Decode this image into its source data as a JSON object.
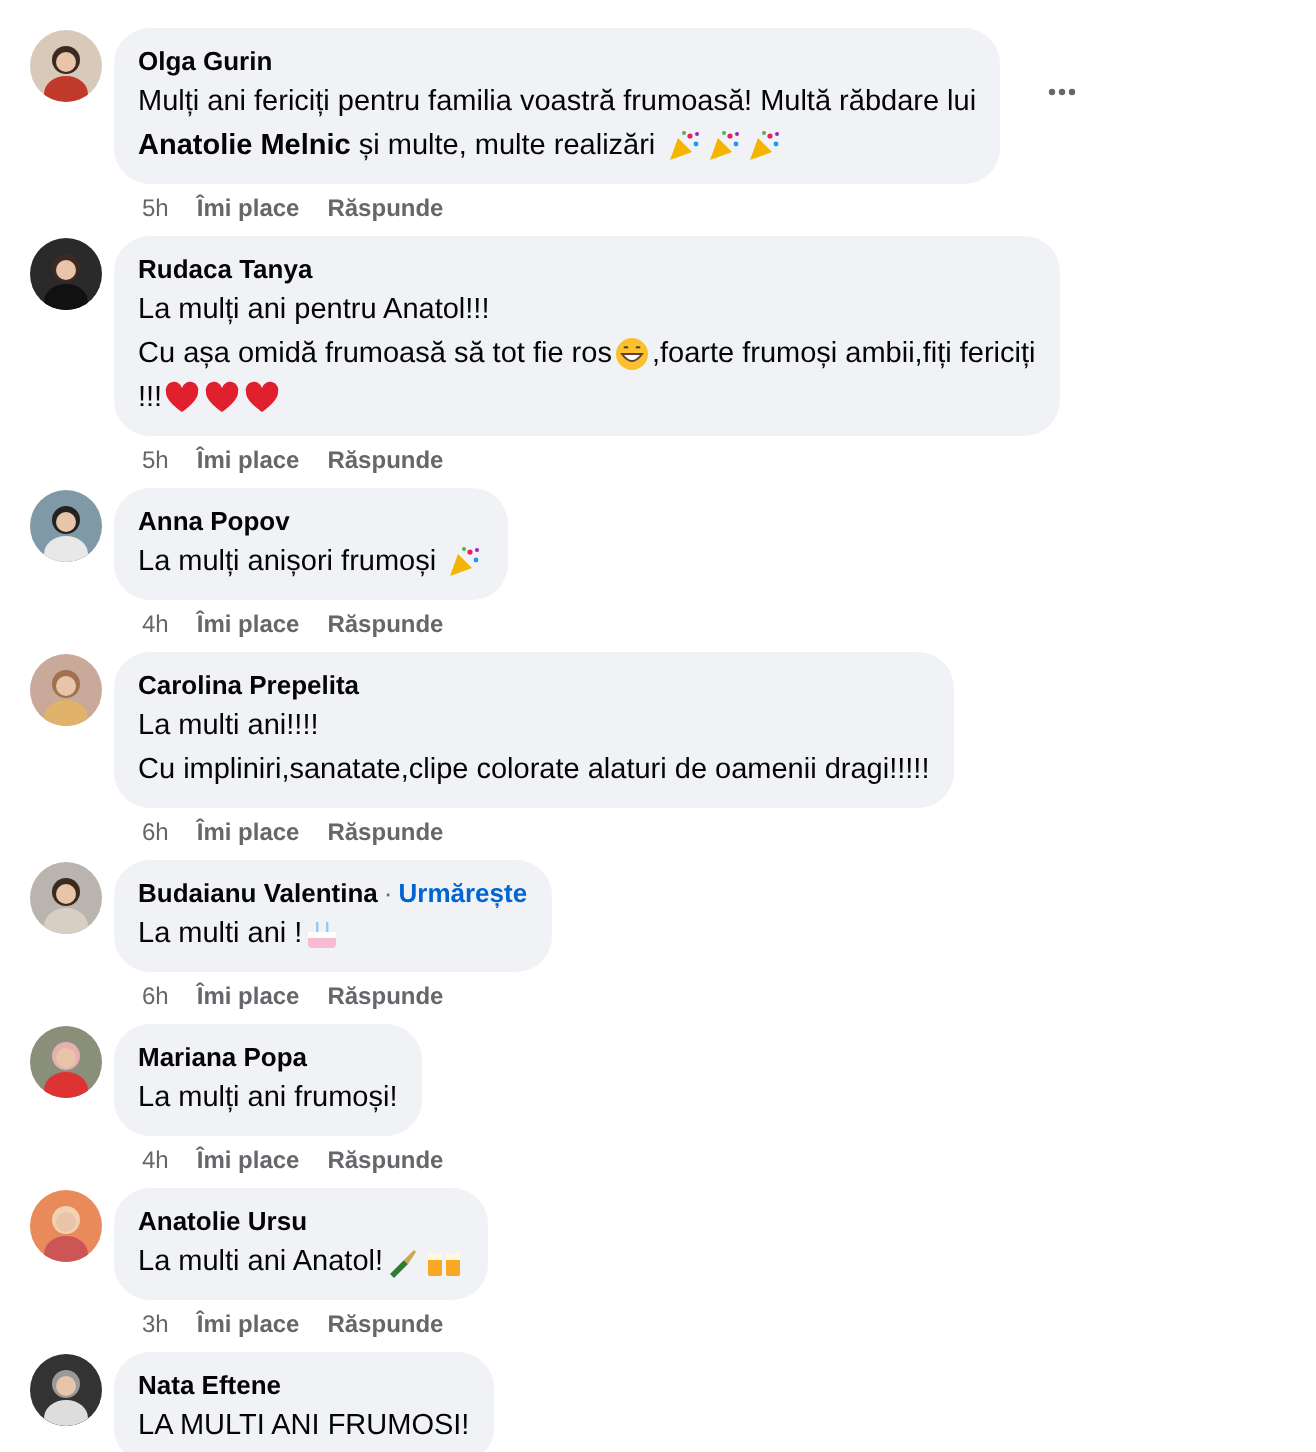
{
  "comments": [
    {
      "author": "Olga Gurin",
      "lines": [
        [
          {
            "kind": "text",
            "text": "Mulți ani fericiți pentru familia voastră frumoasă! Multă răbdare lui"
          }
        ],
        [
          {
            "kind": "text",
            "text": "**Anatolie Melnic** și multe, multe realizări "
          },
          {
            "kind": "party"
          },
          {
            "kind": "party"
          },
          {
            "kind": "party"
          }
        ]
      ],
      "time": "5h",
      "like": "Îmi place",
      "reply": "Răspunde",
      "menu": true
    },
    {
      "author": "Rudaca Tanya",
      "lines": [
        [
          {
            "kind": "text",
            "text": "La mulți ani pentru Anatol!!!"
          }
        ],
        [
          {
            "kind": "text",
            "text": "Cu așa omidă frumoasă să tot fie ros"
          },
          {
            "kind": "grin"
          },
          {
            "kind": "text",
            "text": ",foarte frumoși ambii,fiți fericiți"
          }
        ],
        [
          {
            "kind": "text",
            "text": "!!!"
          },
          {
            "kind": "heart"
          },
          {
            "kind": "heart"
          },
          {
            "kind": "heart"
          }
        ]
      ],
      "time": "5h",
      "like": "Îmi place",
      "reply": "Răspunde",
      "menu": false
    },
    {
      "author": "Anna Popov",
      "lines": [
        [
          {
            "kind": "text",
            "text": "La mulți anișori frumoși "
          },
          {
            "kind": "party"
          }
        ]
      ],
      "time": "4h",
      "like": "Îmi place",
      "reply": "Răspunde",
      "menu": false
    },
    {
      "author": "Carolina Prepelita",
      "lines": [
        [
          {
            "kind": "text",
            "text": "La multi ani!!!!"
          }
        ],
        [
          {
            "kind": "text",
            "text": "Cu impliniri,sanatate,clipe colorate alaturi de oamenii dragi!!!!!"
          }
        ]
      ],
      "time": "6h",
      "like": "Îmi place",
      "reply": "Răspunde",
      "menu": false
    },
    {
      "author": "Budaianu Valentina",
      "separator": "·",
      "follow": "Urmărește",
      "lines": [
        [
          {
            "kind": "text",
            "text": "La multi ani !"
          },
          {
            "kind": "cake"
          }
        ]
      ],
      "time": "6h",
      "like": "Îmi place",
      "reply": "Răspunde",
      "menu": false
    },
    {
      "author": "Mariana Popa",
      "lines": [
        [
          {
            "kind": "text",
            "text": "La mulți ani frumoși!"
          }
        ]
      ],
      "time": "4h",
      "like": "Îmi place",
      "reply": "Răspunde",
      "menu": false
    },
    {
      "author": "Anatolie Ursu",
      "lines": [
        [
          {
            "kind": "text",
            "text": "La multi ani Anatol!"
          },
          {
            "kind": "bottle"
          },
          {
            "kind": "mugs"
          }
        ]
      ],
      "time": "3h",
      "like": "Îmi place",
      "reply": "Răspunde",
      "menu": false
    },
    {
      "author": "Nata Eftene",
      "lines": [
        [
          {
            "kind": "text",
            "text": "LA MULTI ANI FRUMOSI!"
          }
        ]
      ]
    }
  ]
}
